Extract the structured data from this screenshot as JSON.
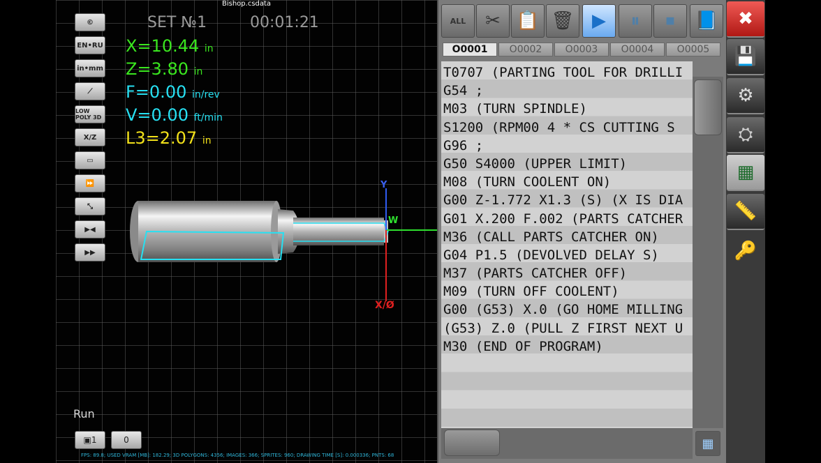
{
  "app": {
    "file_title": "Bishop.csdata",
    "set_title": "SET №1",
    "timer": "00:01:21"
  },
  "left_tools": [
    {
      "name": "copyright-icon",
      "glyph": "©"
    },
    {
      "name": "language-toggle-icon",
      "glyph": "EN•RU"
    },
    {
      "name": "units-toggle-icon",
      "glyph": "in•mm"
    },
    {
      "name": "hide-tool-icon",
      "glyph": "⟋"
    },
    {
      "name": "low-poly-3d-icon",
      "glyph": "LOW POLY 3D"
    },
    {
      "name": "xz-display-icon",
      "glyph": "X/Z"
    },
    {
      "name": "toolpath-icon",
      "glyph": "▭"
    },
    {
      "name": "fast-forward-icon",
      "glyph": "⏩"
    },
    {
      "name": "zoom-fit-icon",
      "glyph": "⤡"
    },
    {
      "name": "step-back-icon",
      "glyph": "▶◀"
    },
    {
      "name": "step-forward-icon",
      "glyph": "▶▶"
    }
  ],
  "readouts": [
    {
      "label": "X=10.44",
      "unit": "in"
    },
    {
      "label": "Z=3.80",
      "unit": "in"
    },
    {
      "label": "F=0.00",
      "unit": "in/rev"
    },
    {
      "label": "V=0.00",
      "unit": "ft/min"
    },
    {
      "label": "L3=2.07",
      "unit": "in"
    }
  ],
  "axes": {
    "y_label": "Y",
    "w_label": "W",
    "x_label": "X/Ø"
  },
  "status": {
    "mode": "Run",
    "camera_button": "▣1",
    "zero_button": "0",
    "stats_line": "FPS: 89.8; USED VRAM [MB]: 182.29; 3D POLYGONS: 4356; IMAGES: 366; SPRITES: 960; DRAWING TIME [S]: 0.000336; PNTS: 68"
  },
  "toolbar": [
    {
      "name": "select-all-button",
      "glyph": "ALL"
    },
    {
      "name": "cut-button",
      "glyph": "✂"
    },
    {
      "name": "paste-button",
      "glyph": "📋"
    },
    {
      "name": "delete-button",
      "glyph": "🗑"
    },
    {
      "name": "run-button",
      "glyph": "▶"
    },
    {
      "name": "pause-button",
      "glyph": "⏸"
    },
    {
      "name": "stop-button",
      "glyph": "⏹"
    },
    {
      "name": "manual-button",
      "glyph": "📘"
    }
  ],
  "program_tabs": [
    "O0001",
    "O0002",
    "O0003",
    "O0004",
    "O0005"
  ],
  "code_lines": [
    "T0707 (PARTING TOOL FOR DRILLI",
    "G54 ;",
    "M03 (TURN SPINDLE)",
    "S1200 (RPM00  4 * CS CUTTING S",
    "G96 ;",
    "G50 S4000 (UPPER LIMIT)",
    "M08 (TURN COOLENT ON)",
    "G00 Z-1.772 X1.3 (S) (X IS DIA",
    "G01 X.200 F.002 (PARTS CATCHER",
    "M36 (CALL PARTS CATCHER ON)",
    "G04 P1.5 (DEVOLVED DELAY S)",
    "M37 (PARTS CATCHER OFF)",
    "M09 (TURN OFF COOLENT)",
    "G00 (G53) X.0 (GO HOME MILLING",
    "(G53) Z.0 (PULL Z FIRST NEXT U",
    "M30 (END OF PROGRAM)"
  ],
  "sidebar": [
    {
      "name": "close-icon",
      "glyph": "✖"
    },
    {
      "name": "save-file-icon",
      "glyph": "💾"
    },
    {
      "name": "chuck-icon",
      "glyph": "⚙"
    },
    {
      "name": "tool-holder-icon",
      "glyph": "⛭"
    },
    {
      "name": "g-code-screen-icon",
      "glyph": "▦"
    },
    {
      "name": "caliper-icon",
      "glyph": "📏"
    },
    {
      "name": "key-icon",
      "glyph": "🔑"
    }
  ],
  "colors": {
    "x_readout": "#3ae61f",
    "f_readout": "#27e0f2",
    "l3_readout": "#f2e11a",
    "close_red": "#d9241f"
  }
}
